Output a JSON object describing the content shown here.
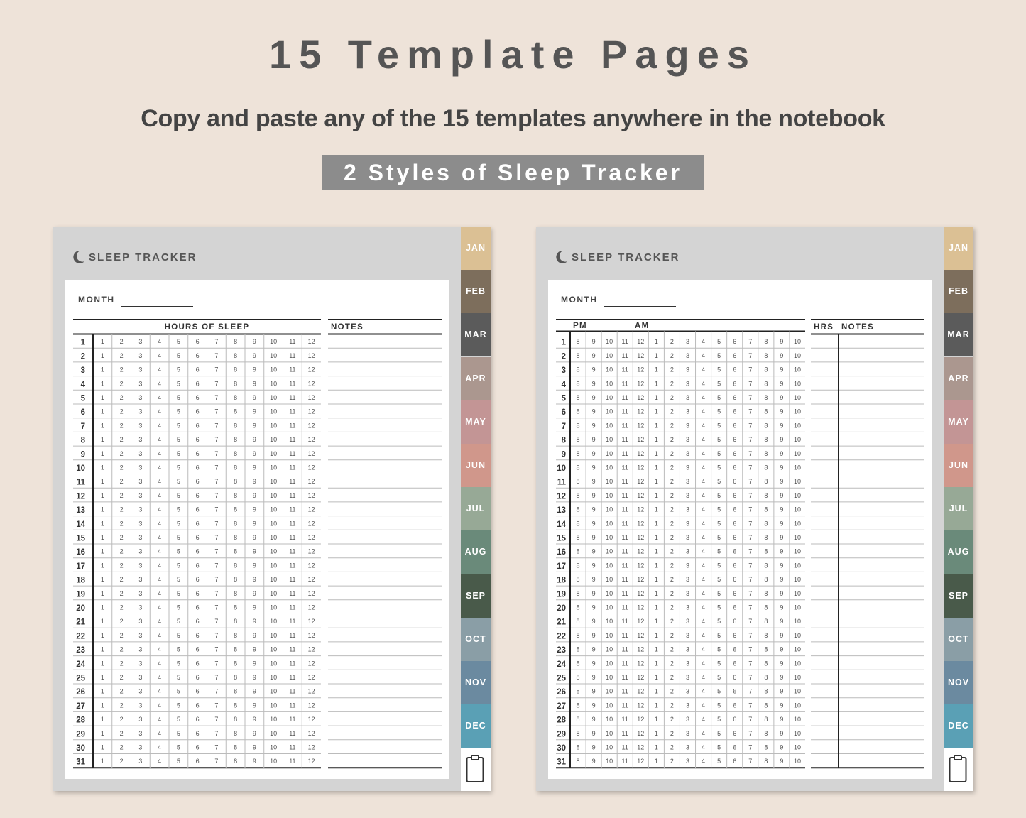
{
  "header": {
    "title": "15 Template Pages",
    "subtitle": "Copy and paste any of the 15 templates anywhere in the notebook",
    "banner": "2 Styles of Sleep Tracker"
  },
  "months": [
    "JAN",
    "FEB",
    "MAR",
    "APR",
    "MAY",
    "JUN",
    "JUL",
    "AUG",
    "SEP",
    "OCT",
    "NOV",
    "DEC"
  ],
  "month_colors": [
    "#dbc094",
    "#7d6e5c",
    "#5b5b5b",
    "#ab978f",
    "#c39595",
    "#d0978b",
    "#97a996",
    "#6a8a7a",
    "#495a4a",
    "#8a9ea6",
    "#6b8aa0",
    "#5aa0b5"
  ],
  "days": [
    "1",
    "2",
    "3",
    "4",
    "5",
    "6",
    "7",
    "8",
    "9",
    "10",
    "11",
    "12",
    "13",
    "14",
    "15",
    "16",
    "17",
    "18",
    "19",
    "20",
    "21",
    "22",
    "23",
    "24",
    "25",
    "26",
    "27",
    "28",
    "29",
    "30",
    "31"
  ],
  "tracker1": {
    "title": "SLEEP TRACKER",
    "month_label": "MONTH",
    "hours_header": "HOURS OF SLEEP",
    "notes_header": "NOTES",
    "hours": [
      "1",
      "2",
      "3",
      "4",
      "5",
      "6",
      "7",
      "8",
      "9",
      "10",
      "11",
      "12"
    ]
  },
  "tracker2": {
    "title": "SLEEP TRACKER",
    "month_label": "MONTH",
    "pm_header": "PM",
    "am_header": "AM",
    "hrs_header": "HRS",
    "notes_header": "NOTES",
    "hours": [
      "8",
      "9",
      "10",
      "11",
      "12",
      "1",
      "2",
      "3",
      "4",
      "5",
      "6",
      "7",
      "8",
      "9",
      "10"
    ]
  },
  "icons": {
    "moon": "moon-icon",
    "clipboard": "clipboard-icon"
  }
}
